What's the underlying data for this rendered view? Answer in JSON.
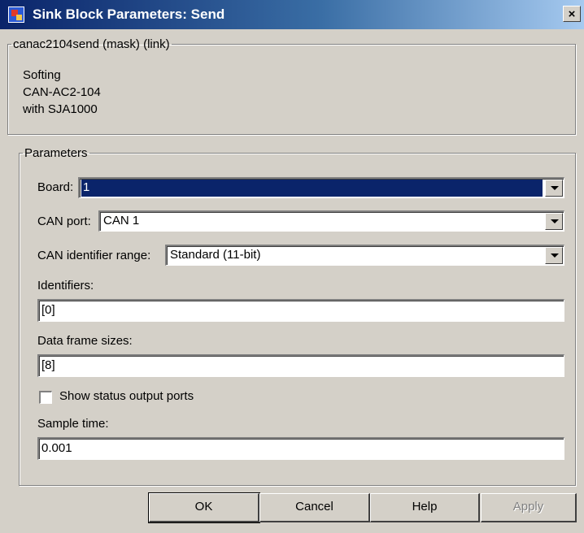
{
  "window": {
    "title": "Sink Block Parameters: Send",
    "close_label": "×"
  },
  "mask_group": {
    "legend": "canac2104send (mask) (link)",
    "description": [
      "Softing",
      "CAN-AC2-104",
      "with SJA1000"
    ]
  },
  "params_group": {
    "legend": "Parameters",
    "board": {
      "label": "Board:",
      "value": "1"
    },
    "can_port": {
      "label": "CAN port:",
      "value": "CAN 1"
    },
    "id_range": {
      "label": "CAN identifier range:",
      "value": "Standard (11-bit)"
    },
    "identifiers": {
      "label": "Identifiers:",
      "value": "[0]"
    },
    "frame_sizes": {
      "label": "Data frame sizes:",
      "value": "[8]"
    },
    "show_status": {
      "label": "Show status output ports",
      "checked": false
    },
    "sample_time": {
      "label": "Sample time:",
      "value": "0.001"
    }
  },
  "buttons": {
    "ok": "OK",
    "cancel": "Cancel",
    "help": "Help",
    "apply": "Apply"
  }
}
